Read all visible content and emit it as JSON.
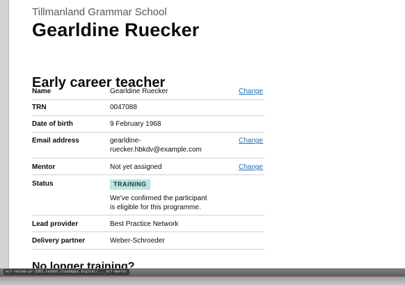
{
  "header": {
    "school": "Tillmanland Grammar School",
    "person": "Gearldine Ruecker"
  },
  "section": {
    "title": "Early career teacher"
  },
  "summary": {
    "name": {
      "key": "Name",
      "value": "Gearldine Ruecker",
      "action": "Change"
    },
    "trn": {
      "key": "TRN",
      "value": "0047088"
    },
    "dob": {
      "key": "Date of birth",
      "value": "9 February 1968"
    },
    "email": {
      "key": "Email address",
      "value_line1": "gearldine-",
      "value_line2": "ruecker.hbkdv@example.com",
      "action": "Change"
    },
    "mentor": {
      "key": "Mentor",
      "value": "Not yet assigned",
      "action": "Change"
    },
    "status": {
      "key": "Status",
      "tag": "TRAINING",
      "note_line1": "We've confirmed the participant",
      "note_line2": "is eligible for this programme."
    },
    "lead_provider": {
      "key": "Lead provider",
      "value": "Best Practice Network"
    },
    "delivery_partner": {
      "key": "Delivery partner",
      "value": "Weber-Schroeder"
    }
  },
  "next_section": {
    "title": "No longer training?"
  },
  "status_bar": {
    "url": "ecf-review-pr-3361.london.cloudapps.digital/..._ecf-mentor"
  },
  "colors": {
    "link": "#1d70b8",
    "tag_bg": "#bfe3e0",
    "tag_text": "#10403c"
  }
}
